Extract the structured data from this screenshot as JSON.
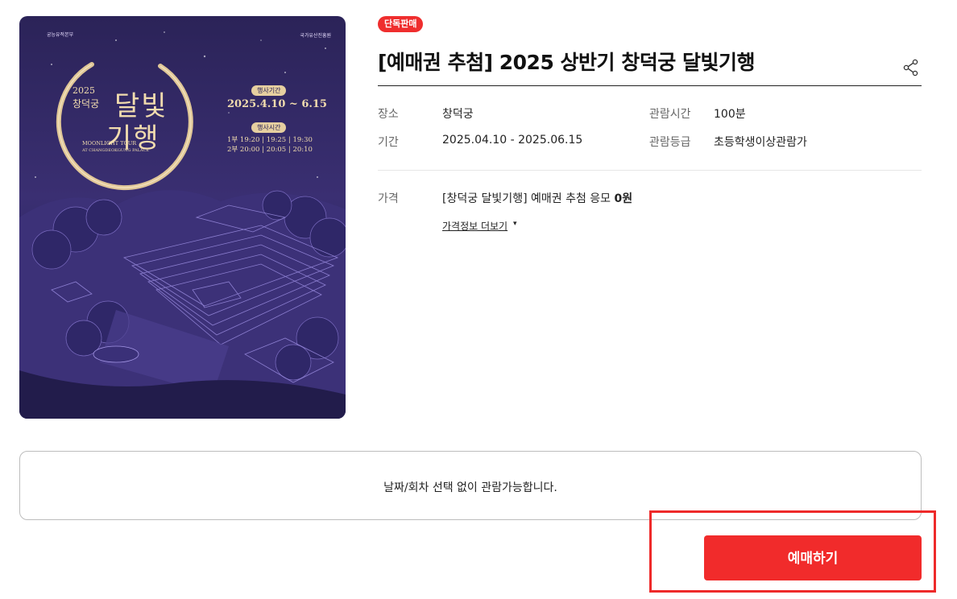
{
  "poster": {
    "org_left": "궁능유적본부",
    "org_right": "국가유산진흥원",
    "year": "2025",
    "palace": "창덕궁",
    "title_line1": "달빛",
    "title_line2": "기행",
    "english_title": "MOONLIGHT TOUR",
    "english_sub": "AT CHANGDEOKGUNG PALACE",
    "period_label": "행사기간",
    "dates": "2025.4.10 ~ 6.15",
    "time_label": "행사시간",
    "times": "1부 19:20 | 19:25 | 19:30\n2부 20:00 | 20:05 | 20:10"
  },
  "badge": "단독판매",
  "title": "[예매권 추첨] 2025 상반기 창덕궁 달빛기행",
  "info": {
    "place_label": "장소",
    "place_value": "창덕궁",
    "period_label": "기간",
    "period_value": "2025.04.10 - 2025.06.15",
    "runtime_label": "관람시간",
    "runtime_value": "100분",
    "rating_label": "관람등급",
    "rating_value": "초등학생이상관람가"
  },
  "price": {
    "label": "가격",
    "item": "[창덕궁 달빛기행] 예매권 추첨 응모",
    "amount": "0원",
    "more": "가격정보 더보기",
    "caret": "▾"
  },
  "notice": "날짜/회차 선택 없이 관람가능합니다.",
  "book_button": "예매하기",
  "colors": {
    "accent": "#f12b2b",
    "poster_bg": "#2b2358",
    "poster_gold": "#f1dcae"
  },
  "icons": {
    "share": "share-icon"
  }
}
